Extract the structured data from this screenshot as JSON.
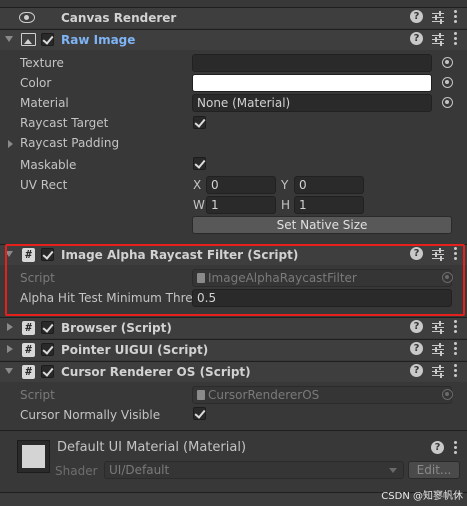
{
  "components": {
    "canvas_renderer": {
      "title": "Canvas Renderer"
    },
    "raw_image": {
      "title": "Raw Image",
      "texture": {
        "label": "Texture",
        "value": ""
      },
      "color": {
        "label": "Color",
        "value": "#FFFFFF"
      },
      "material": {
        "label": "Material",
        "value": "None (Material)"
      },
      "raycast_target": {
        "label": "Raycast Target",
        "checked": true
      },
      "raycast_padding": {
        "label": "Raycast Padding"
      },
      "maskable": {
        "label": "Maskable",
        "checked": true
      },
      "uv_rect": {
        "label": "UV Rect",
        "x_label": "X",
        "x": "0",
        "y_label": "Y",
        "y": "0",
        "w_label": "W",
        "w": "1",
        "h_label": "H",
        "h": "1"
      },
      "set_native_size": "Set Native Size"
    },
    "alpha_filter": {
      "title": "Image Alpha Raycast Filter (Script)",
      "script_label": "Script",
      "script_value": "ImageAlphaRaycastFilter",
      "threshold_label": "Alpha Hit Test Minimum Thresl",
      "threshold_value": "0.5"
    },
    "browser": {
      "title": "Browser (Script)"
    },
    "pointer": {
      "title": "Pointer UIGUI (Script)"
    },
    "cursor_renderer": {
      "title": "Cursor Renderer OS (Script)",
      "script_label": "Script",
      "script_value": "CursorRendererOS",
      "visible_label": "Cursor Normally Visible",
      "visible_checked": true
    }
  },
  "material": {
    "title": "Default UI Material (Material)",
    "shader_label": "Shader",
    "shader_value": "UI/Default",
    "edit_label": "Edit..."
  },
  "watermark": "CSDN @知寥帆休",
  "icons": {
    "help": "?",
    "script": "#"
  }
}
